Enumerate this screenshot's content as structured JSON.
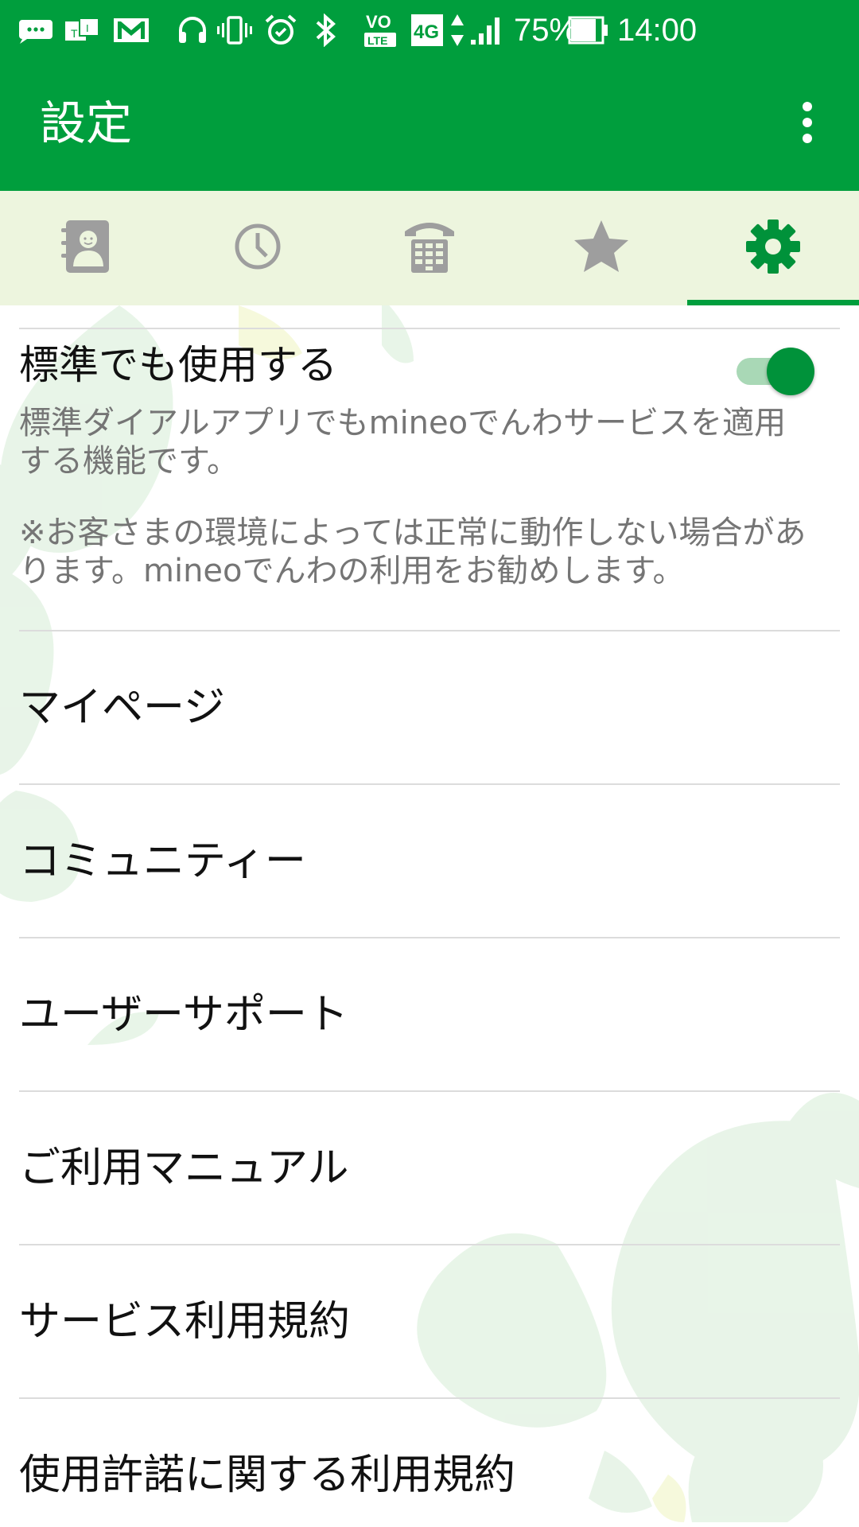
{
  "status_bar": {
    "battery": "75%",
    "time": "14:00",
    "network": "4G",
    "volte": "VoLTE",
    "icons": [
      "message-icon",
      "ime-icon",
      "gmail-icon",
      "headphones-icon",
      "vibrate-icon",
      "alarm-icon",
      "bluetooth-icon",
      "volte-icon",
      "4g-icon",
      "data-arrows-icon",
      "signal-icon",
      "battery-icon"
    ]
  },
  "app_bar": {
    "title": "設定",
    "menu_icon": "more-vert-icon"
  },
  "tabs": [
    {
      "icon": "contacts-icon",
      "active": false
    },
    {
      "icon": "history-icon",
      "active": false
    },
    {
      "icon": "dialpad-icon",
      "active": false
    },
    {
      "icon": "star-icon",
      "active": false
    },
    {
      "icon": "gear-icon",
      "active": true
    }
  ],
  "settings": {
    "default_dialer": {
      "title": "標準でも使用する",
      "summary_line1": "標準ダイアルアプリでもmineoでんわサービスを適用",
      "summary_line2": "する機能です。",
      "note_line1": "※お客さまの環境によっては正常に動作しない場合があ",
      "note_line2": "ります。mineoでんわの利用をお勧めします。",
      "enabled": true
    },
    "menu_items": [
      {
        "label": "マイページ"
      },
      {
        "label": "コミュニティー"
      },
      {
        "label": "ユーザーサポート"
      },
      {
        "label": "ご利用マニュアル"
      },
      {
        "label": "サービス利用規約"
      },
      {
        "label": "使用許諾に関する利用規約"
      }
    ]
  },
  "colors": {
    "primary": "#009e3d",
    "tab_bar_bg": "#edf5de",
    "tab_icon_inactive": "#9e9e9e",
    "tab_icon_active": "#00923a",
    "toggle_track": "#a9d8b6",
    "summary_text": "#757575"
  }
}
